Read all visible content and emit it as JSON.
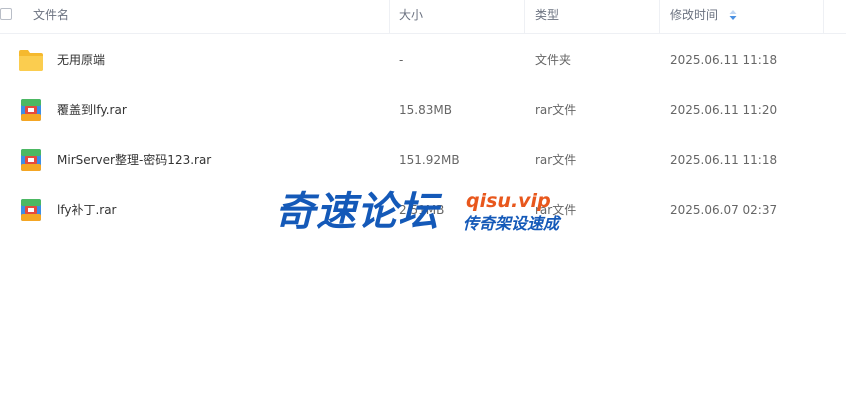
{
  "columns": {
    "name": "文件名",
    "size": "大小",
    "type": "类型",
    "modified": "修改时间"
  },
  "sort_icon": "sort-updown-icon",
  "rows": [
    {
      "icon": "folder-icon",
      "name": "无用原端",
      "size": "-",
      "type": "文件夹",
      "modified": "2025.06.11 11:18"
    },
    {
      "icon": "archive-icon",
      "name": "覆盖到lfy.rar",
      "size": "15.83MB",
      "type": "rar文件",
      "modified": "2025.06.11 11:20"
    },
    {
      "icon": "archive-icon",
      "name": "MirServer整理-密码123.rar",
      "size": "151.92MB",
      "type": "rar文件",
      "modified": "2025.06.11 11:18"
    },
    {
      "icon": "archive-icon",
      "name": "lfy补丁.rar",
      "size": "2.51MB",
      "type": "rar文件",
      "modified": "2025.06.07 02:37"
    }
  ],
  "watermark": {
    "title": "奇速论坛",
    "domain": "qisu.vip",
    "slogan": "传奇架设速成"
  },
  "colors": {
    "folder": "#f7c64a",
    "archive_red": "#e64a3c",
    "archive_green": "#4cb862",
    "archive_blue": "#3b8ee8",
    "watermark_blue": "#1459b8",
    "watermark_orange": "#e8571c",
    "sort_arrow": "#4a90e2"
  }
}
